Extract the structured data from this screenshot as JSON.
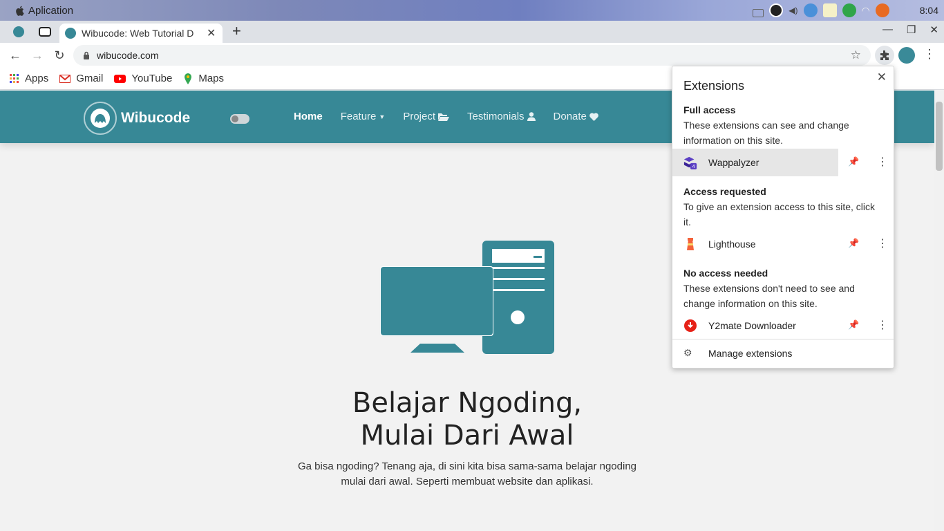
{
  "os": {
    "app_name": "Aplication",
    "time": "8:04"
  },
  "browser": {
    "tab_title": "Wibucode: Web Tutorial D",
    "url": "wibucode.com",
    "bookmarks": [
      {
        "label": "Apps"
      },
      {
        "label": "Gmail"
      },
      {
        "label": "YouTube"
      },
      {
        "label": "Maps"
      }
    ]
  },
  "site": {
    "brand": "Wibucode",
    "nav": {
      "home": "Home",
      "feature": "Feature",
      "project": "Project",
      "testimonials": "Testimonials",
      "donate": "Donate"
    },
    "hero": {
      "title_line1": "Belajar Ngoding,",
      "title_line2": "Mulai Dari Awal",
      "subtitle_line1": "Ga bisa ngoding? Tenang aja, di sini kita bisa sama-sama belajar ngoding",
      "subtitle_line2": "mulai dari awal. Seperti membuat website dan aplikasi."
    }
  },
  "extensions": {
    "title": "Extensions",
    "full_access": {
      "heading": "Full access",
      "desc": "These extensions can see and change information on this site.",
      "items": [
        {
          "name": "Wappalyzer",
          "icon": "wappalyzer-icon"
        }
      ]
    },
    "access_requested": {
      "heading": "Access requested",
      "desc": "To give an extension access to this site, click it.",
      "items": [
        {
          "name": "Lighthouse",
          "icon": "lighthouse-icon"
        }
      ]
    },
    "no_access": {
      "heading": "No access needed",
      "desc": "These extensions don't need to see and change information on this site.",
      "items": [
        {
          "name": "Y2mate Downloader",
          "icon": "y2mate-icon"
        }
      ]
    },
    "manage": "Manage extensions"
  },
  "colors": {
    "brand": "#378896",
    "page_bg": "#f2f2f2"
  }
}
